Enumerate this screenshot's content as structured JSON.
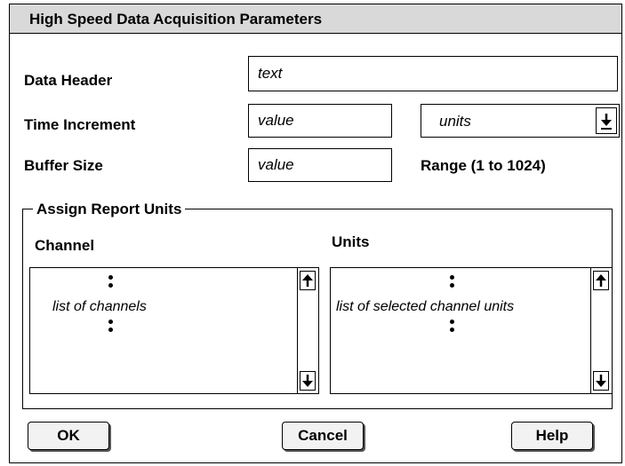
{
  "dialog": {
    "title": "High Speed Data Acquisition Parameters"
  },
  "form": {
    "data_header": {
      "label": "Data Header",
      "value": "text"
    },
    "time_increment": {
      "label": "Time Increment",
      "value": "value",
      "units_value": "units"
    },
    "buffer_size": {
      "label": "Buffer Size",
      "value": "value",
      "range": "Range (1 to 1024)"
    }
  },
  "report_units": {
    "group_label": "Assign Report Units",
    "channel_header": "Channel",
    "units_header": "Units",
    "channels_list_text": "list of channels",
    "units_list_text": "list of selected channel units"
  },
  "buttons": {
    "ok": "OK",
    "cancel": "Cancel",
    "help": "Help"
  },
  "colors": {
    "titlebar": "#d9d9d9",
    "border": "#000000"
  }
}
